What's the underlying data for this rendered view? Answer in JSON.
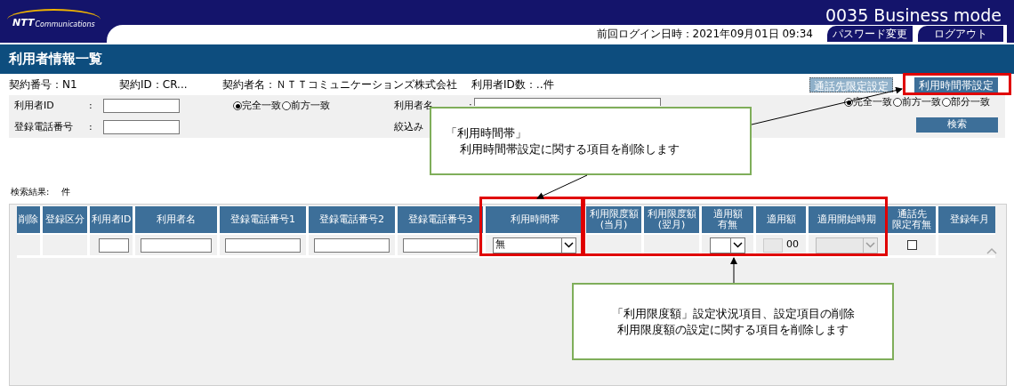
{
  "header": {
    "logo": {
      "mark": "NTT",
      "text": "Communications"
    },
    "brand": "0035 Business mode",
    "last_login": "前回ログイン日時：2021年09月01日 09:34",
    "tabs": [
      "パスワード変更",
      "ログアウト"
    ]
  },
  "page_title": "利用者情報一覧",
  "contract_info": [
    "契約番号：N1",
    "契約ID：CR...",
    "契約者名：ＮＴＴコミュニケーションズ株式会社",
    "利用者ID数：‥件"
  ],
  "action_buttons": [
    {
      "label": "通話先限定設定",
      "disabled": true
    },
    {
      "label": "利用時間帯設定",
      "disabled": false
    }
  ],
  "search": {
    "fields": [
      {
        "label": "利用者ID",
        "colon": ":",
        "match_options": [
          {
            "label": "完全一致",
            "selected": true
          },
          {
            "label": "前方一致",
            "selected": false
          }
        ]
      },
      {
        "label": "利用者名",
        "colon": ":",
        "match_options": [
          {
            "label": "完全一致",
            "selected": true
          },
          {
            "label": "前方一致",
            "selected": false
          },
          {
            "label": "部分一致",
            "selected": false
          }
        ]
      },
      {
        "label": "登録電話番号",
        "colon": ":"
      },
      {
        "label": "絞込み"
      }
    ],
    "button": "検索"
  },
  "result": {
    "label": "検索結果:",
    "count": "件"
  },
  "table": {
    "columns": [
      [
        "削除"
      ],
      [
        "登録区分"
      ],
      [
        "利用者ID"
      ],
      [
        "利用者名"
      ],
      [
        "登録電話番号1"
      ],
      [
        "登録電話番号2"
      ],
      [
        "登録電話番号3"
      ],
      [
        "利用時間帯"
      ],
      [
        "利用限度額",
        "(当月)"
      ],
      [
        "利用限度額",
        "(翌月)"
      ],
      [
        "適用額",
        "有無"
      ],
      [
        "適用額"
      ],
      [
        "適用開始時期"
      ],
      [
        "通話先",
        "限定有無"
      ],
      [
        "登録年月"
      ]
    ],
    "row": [
      {
        "kind": "empty"
      },
      {
        "kind": "empty"
      },
      {
        "kind": "input"
      },
      {
        "kind": "input"
      },
      {
        "kind": "input"
      },
      {
        "kind": "input"
      },
      {
        "kind": "input"
      },
      {
        "kind": "select",
        "value": "無"
      },
      {
        "kind": "empty"
      },
      {
        "kind": "empty"
      },
      {
        "kind": "select"
      },
      {
        "kind": "amount",
        "value": "00"
      },
      {
        "kind": "select",
        "disabled": true
      },
      {
        "kind": "checkbox",
        "checked": false
      },
      {
        "kind": "empty"
      }
    ]
  },
  "annotations": [
    {
      "lines": [
        "「利用時間帯」",
        "利用時間帯設定に関する項目を削除します"
      ]
    },
    {
      "lines": [
        "「利用限度額」設定状況項目、設定項目の削除",
        "利用限度額の設定に関する項目を削除します"
      ]
    }
  ]
}
